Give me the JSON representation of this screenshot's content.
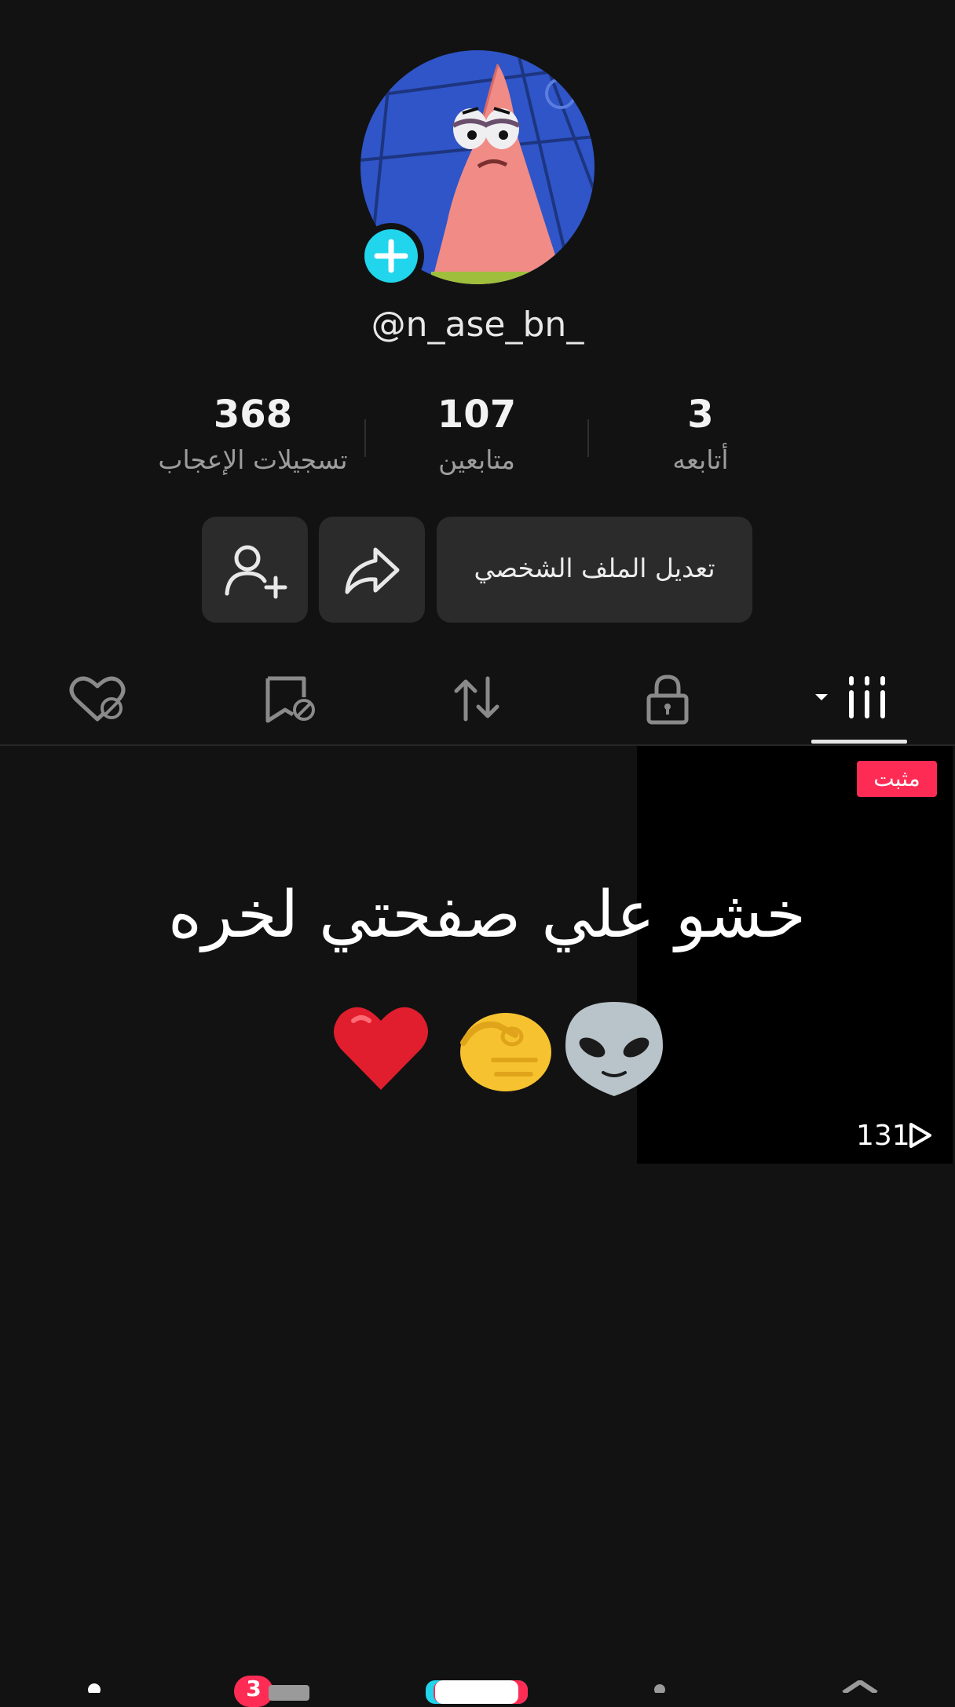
{
  "profile": {
    "username": "@n_ase_bn_",
    "stats": [
      {
        "value": "368",
        "label": "تسجيلات الإعجاب"
      },
      {
        "value": "107",
        "label": "متابعين"
      },
      {
        "value": "3",
        "label": "أتابعه"
      }
    ]
  },
  "actions": {
    "edit_profile_label": "تعديل الملف الشخصي"
  },
  "tabs": [
    {
      "icon": "liked-hidden-icon"
    },
    {
      "icon": "favorites-hidden-icon"
    },
    {
      "icon": "reposts-icon"
    },
    {
      "icon": "private-lock-icon"
    },
    {
      "icon": "videos-grid-icon",
      "active": true
    }
  ],
  "video": {
    "pinned_label": "مثبت",
    "caption": "خشو علي صفحتي لخره",
    "emojis": [
      "alien",
      "pinching-hand",
      "red-heart"
    ],
    "views": "131"
  },
  "bottom_nav": {
    "inbox_badge": "3"
  },
  "colors": {
    "background": "#121212",
    "accent_red": "#fe2c55",
    "accent_cyan": "#20d5ec"
  }
}
